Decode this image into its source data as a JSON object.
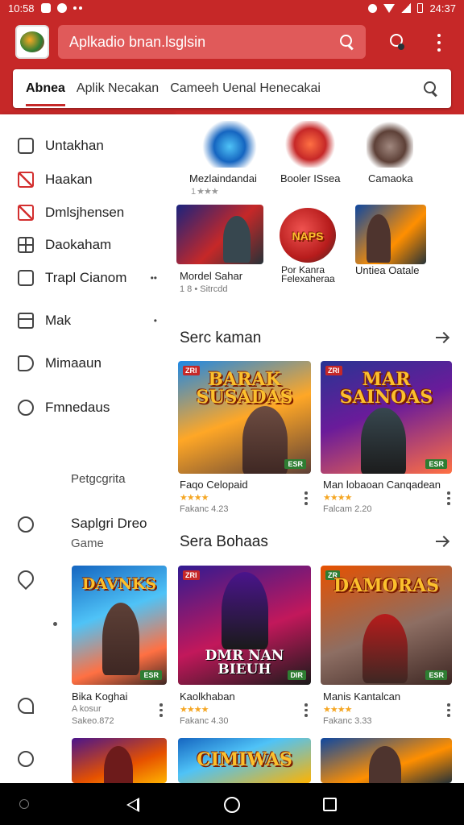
{
  "status_bar": {
    "time": "10:58",
    "time_right": "24:37"
  },
  "header": {
    "search_text": "Aplkadio bnan.lsglsin",
    "tabs": [
      "Abnea",
      "Aplik Necakan",
      "Cameeh Uenal Henecakai"
    ]
  },
  "sidebar": {
    "items": [
      {
        "label": "Untakhan",
        "icon": "square-icon"
      },
      {
        "label": "Haakan",
        "icon": "red-square-icon"
      },
      {
        "label": "Dmlsjhensen",
        "icon": "red-box-icon"
      },
      {
        "label": "Daokaham",
        "icon": "grid-icon"
      },
      {
        "label": "Trapl Cianom",
        "icon": "square-icon",
        "extra": "••"
      },
      {
        "label": "Mak",
        "icon": "calendar-icon",
        "extra": "•"
      },
      {
        "label": "Mimaaun",
        "icon": "shield-icon"
      },
      {
        "label": "Fmnedaus",
        "icon": "clock-icon"
      }
    ],
    "category_label": "Petgcgrita",
    "featured_title": "Saplgri Dreo",
    "featured_sub": "Game",
    "card1_title": "Bika Koghai",
    "card1_line1": "A kosur",
    "card1_line2": "Sakeo.872"
  },
  "content": {
    "top_row": [
      {
        "title": "Mezlaindandai",
        "sub": "1 ★★★"
      },
      {
        "title": "Booler ISsea",
        "sub": ""
      },
      {
        "title": "Camaoka",
        "sub": ""
      }
    ],
    "second_row": [
      {
        "title": "Mordel Sahar",
        "sub": "1 8 • Sitrcdd"
      },
      {
        "title": "Por Kanra Felexaheraa",
        "art": "NAPS"
      },
      {
        "title": "Untiea Oatale"
      }
    ],
    "section1": {
      "title": "Serc kaman",
      "games": [
        {
          "title": "Faqo Celopaid",
          "sub": "Fakanc 4.23",
          "art": "BARAK SUSADAS",
          "badge": "ESR"
        },
        {
          "title": "Man lobaoan Canqadean",
          "sub": "Falcam 2.20",
          "art": "MAR SAINOAS",
          "badge": "ESR"
        }
      ]
    },
    "section2": {
      "title": "Sera Bohaas",
      "games": [
        {
          "title": "Kaolkhaban",
          "sub": "Fakanc 4.30",
          "art": "DMR NAN BIEUH",
          "badge": "DIR"
        },
        {
          "title": "Manis Kantalcan",
          "sub": "Fakanc 3.33",
          "art": "DAMORAS",
          "badge": "ESR"
        }
      ]
    },
    "side_card_art": "DAVNKS",
    "bottom_art": "CIMIWAS"
  },
  "colors": {
    "brand": "#c62828",
    "star": "#f5a623",
    "badge": "#2e7d32"
  }
}
